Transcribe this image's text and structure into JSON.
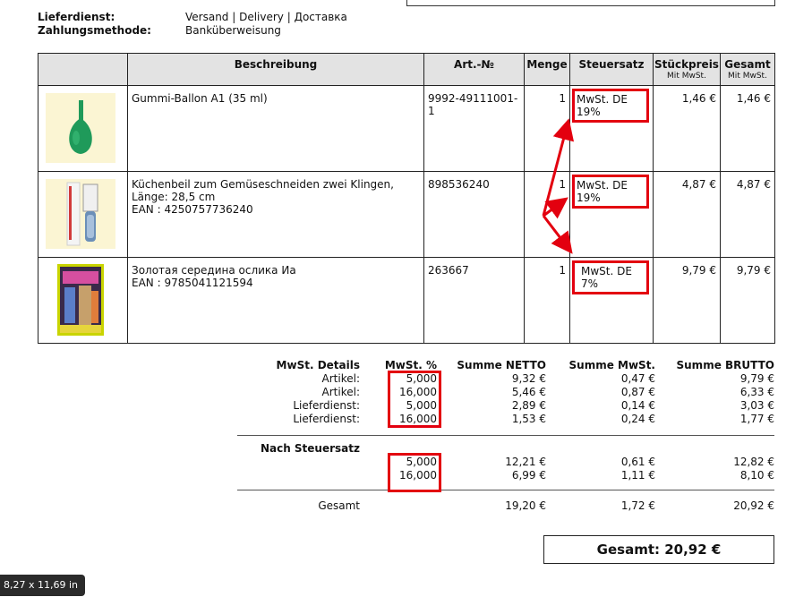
{
  "meta": {
    "delivery_label": "Lieferdienst:",
    "delivery_value": "Versand | Delivery | Доставка",
    "payment_label": "Zahlungsmethode:",
    "payment_value": "Banküberweisung"
  },
  "table": {
    "headers": {
      "description": "Beschreibung",
      "article": "Art.-№",
      "quantity": "Menge",
      "tax_rate": "Steuersatz",
      "unit_price": "Stückpreis",
      "unit_price_sub": "Mit MwSt.",
      "total": "Gesamt",
      "total_sub": "Mit MwSt."
    },
    "rows": [
      {
        "description": "Gummi-Ballon A1 (35 ml)",
        "ean": "",
        "article": "9992-49111001-1",
        "quantity": "1",
        "tax": "MwSt. DE 19%",
        "unit_price": "1,46 €",
        "total": "1,46 €"
      },
      {
        "description": "Küchenbeil zum Gemüseschneiden zwei Klingen, Länge: 28,5 cm",
        "ean": "EAN : 4250757736240",
        "article": "898536240",
        "quantity": "1",
        "tax": "MwSt. DE 19%",
        "unit_price": "4,87 €",
        "total": "4,87 €"
      },
      {
        "description": "Золотая середина ослика Иа",
        "ean": "EAN : 9785041121594",
        "article": "263667",
        "quantity": "1",
        "tax": "MwSt. DE 7%",
        "unit_price": "9,79 €",
        "total": "9,79 €"
      }
    ]
  },
  "summary": {
    "headers": {
      "details": "MwSt. Details",
      "rate": "MwSt. %",
      "netto": "Summe NETTO",
      "vat": "Summe MwSt.",
      "brutto": "Summe BRUTTO"
    },
    "detail_rows": [
      {
        "label": "Artikel:",
        "rate": "5,000",
        "netto": "9,32 €",
        "vat": "0,47 €",
        "brutto": "9,79 €"
      },
      {
        "label": "Artikel:",
        "rate": "16,000",
        "netto": "5,46 €",
        "vat": "0,87 €",
        "brutto": "6,33 €"
      },
      {
        "label": "Lieferdienst:",
        "rate": "5,000",
        "netto": "2,89 €",
        "vat": "0,14 €",
        "brutto": "3,03 €"
      },
      {
        "label": "Lieferdienst:",
        "rate": "16,000",
        "netto": "1,53 €",
        "vat": "0,24 €",
        "brutto": "1,77 €"
      }
    ],
    "by_rate_label": "Nach Steuersatz",
    "by_rate_rows": [
      {
        "rate": "5,000",
        "netto": "12,21 €",
        "vat": "0,61 €",
        "brutto": "12,82 €"
      },
      {
        "rate": "16,000",
        "netto": "6,99 €",
        "vat": "1,11 €",
        "brutto": "8,10 €"
      }
    ],
    "total_label": "Gesamt",
    "total_netto": "19,20 €",
    "total_vat": "1,72 €",
    "total_brutto": "20,92 €"
  },
  "grand_total": "Gesamt: 20,92 €",
  "page_size_badge": "8,27 x 11,69 in",
  "colors": {
    "highlight": "#e3000f",
    "header_bg": "#e3e3e3"
  }
}
